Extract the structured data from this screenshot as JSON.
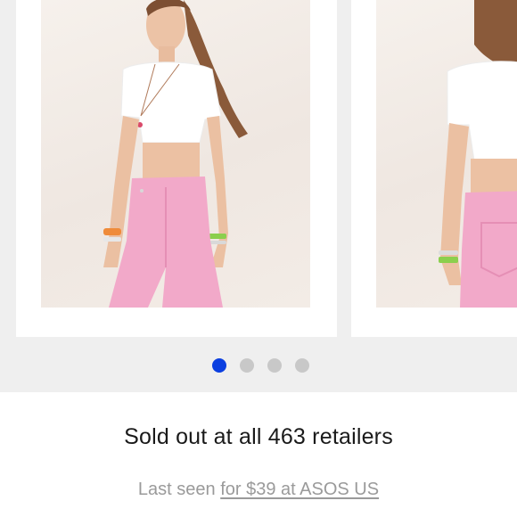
{
  "carousel": {
    "dots_count": 4,
    "active_index": 0
  },
  "product": {
    "status_text": "Sold out at all 463 retailers",
    "last_seen_prefix": "Last seen",
    "last_seen_link": "for $39 at ASOS US"
  },
  "colors": {
    "active_dot": "#0b3fe0",
    "inactive_dot": "#c8c8c8",
    "carousel_bg": "#efefef",
    "jeans_pink": "#f2a9c9"
  }
}
